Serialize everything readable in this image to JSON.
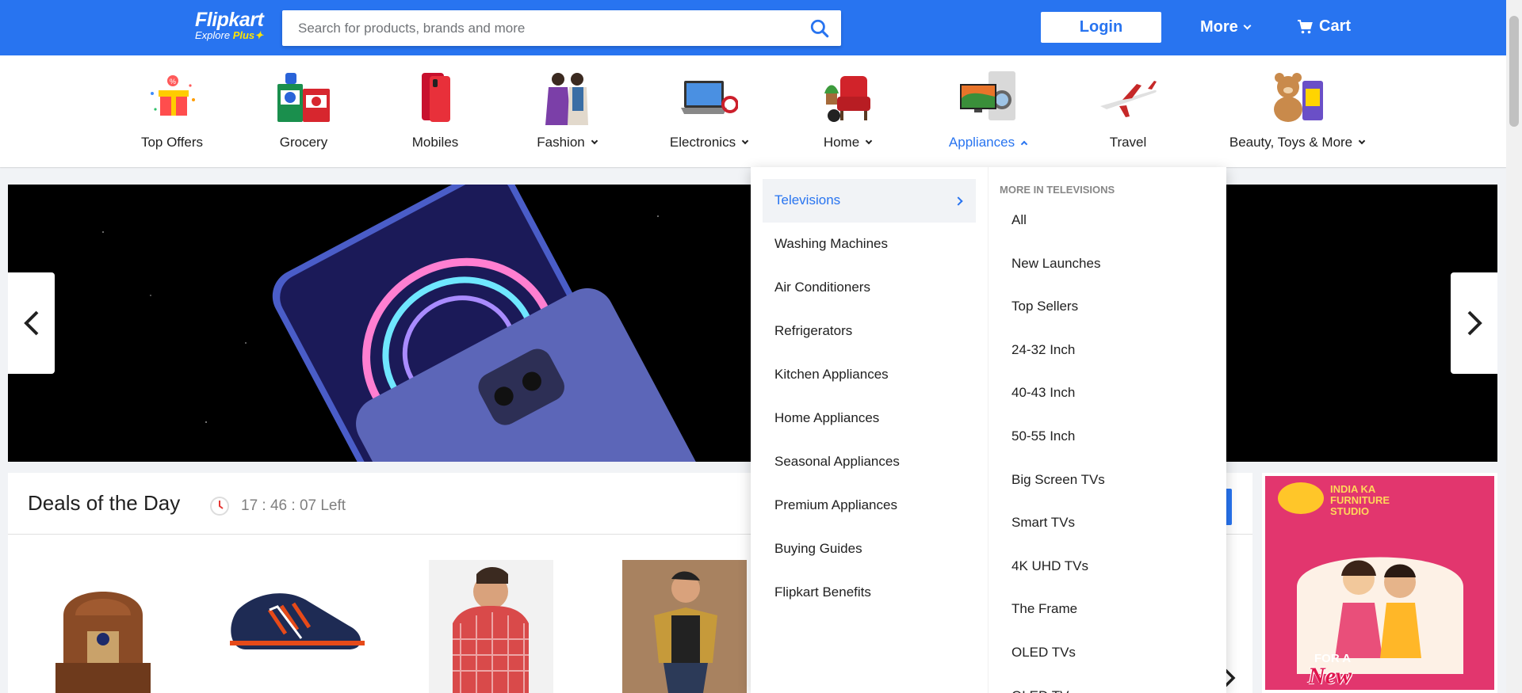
{
  "header": {
    "logo_brand": "Flipkart",
    "logo_sub": "Explore",
    "logo_plus": "Plus",
    "search_placeholder": "Search for products, brands and more",
    "login_label": "Login",
    "more_label": "More",
    "cart_label": "Cart"
  },
  "categories": [
    {
      "label": "Top Offers",
      "icon": "gift-box-icon"
    },
    {
      "label": "Grocery",
      "icon": "grocery-icon"
    },
    {
      "label": "Mobiles",
      "icon": "mobile-phone-icon"
    },
    {
      "label": "Fashion",
      "icon": "fashion-icon"
    },
    {
      "label": "Electronics",
      "icon": "laptop-icon"
    },
    {
      "label": "Home",
      "icon": "armchair-icon"
    },
    {
      "label": "Appliances",
      "icon": "appliances-icon"
    },
    {
      "label": "Travel",
      "icon": "airplane-icon"
    },
    {
      "label": "Beauty, Toys & More",
      "icon": "teddy-bear-icon"
    }
  ],
  "dropdown": {
    "left_items": [
      "Televisions",
      "Washing Machines",
      "Air Conditioners",
      "Refrigerators",
      "Kitchen Appliances",
      "Home Appliances",
      "Seasonal Appliances",
      "Premium Appliances",
      "Buying Guides",
      "Flipkart Benefits"
    ],
    "right_heading": "MORE IN TELEVISIONS",
    "right_items": [
      "All",
      "New Launches",
      "Top Sellers",
      "24-32 Inch",
      "40-43 Inch",
      "50-55 Inch",
      "Big Screen TVs",
      "Smart TVs",
      "4K UHD TVs",
      "The Frame",
      "OLED TVs",
      "QLED TVs"
    ]
  },
  "deals": {
    "title": "Deals of the Day",
    "timer": "17 : 46 : 07 Left"
  },
  "side_ad": {
    "line1": "INDIA KA",
    "line2": "FURNITURE",
    "line3": "STUDIO",
    "tagline_for": "FOR A",
    "tagline_new": "New"
  },
  "colors": {
    "brand_blue": "#2874f0",
    "brand_yellow": "#ffe500",
    "ad_pink": "#e2366e"
  }
}
